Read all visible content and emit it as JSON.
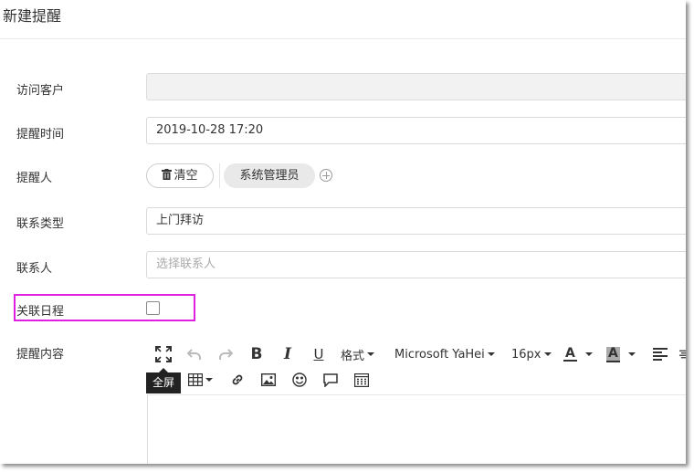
{
  "dialog": {
    "title": "新建提醒"
  },
  "form": {
    "customer": {
      "label": "访问客户",
      "value": ""
    },
    "remind_time": {
      "label": "提醒时间",
      "value": "2019-10-28 17:20"
    },
    "reminder": {
      "label": "提醒人",
      "clear_label": "清空",
      "users": [
        "系统管理员"
      ]
    },
    "contact_type": {
      "label": "联系类型",
      "value": "上门拜访"
    },
    "contact": {
      "label": "联系人",
      "placeholder": "选择联系人"
    },
    "schedule": {
      "label": "关联日程",
      "checked": false
    },
    "content": {
      "label": "提醒内容"
    }
  },
  "editor": {
    "toolbar": {
      "format_label": "格式",
      "font_label": "Microsoft YaHei",
      "size_label": "16px",
      "fullscreen_tooltip": "全屏",
      "font_color_glyph": "A",
      "bg_color_glyph": "A"
    }
  },
  "colors": {
    "highlight": "#e020e0",
    "tooltip_bg": "#222222"
  }
}
